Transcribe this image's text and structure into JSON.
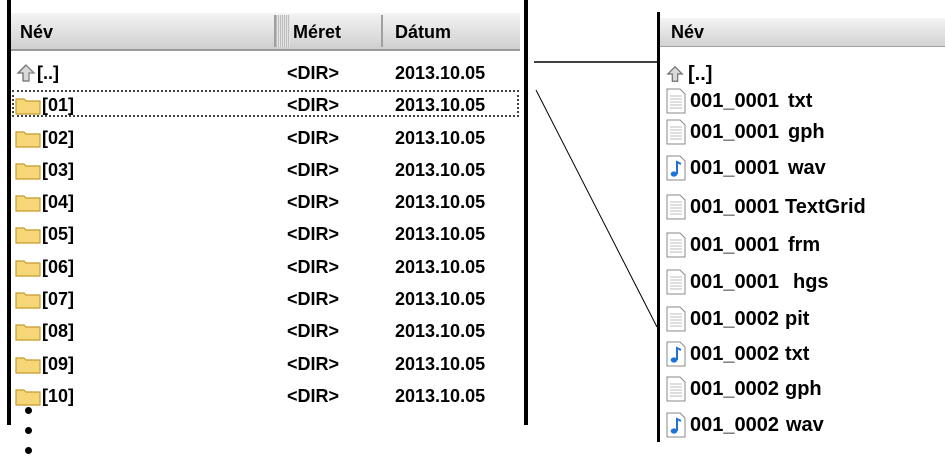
{
  "left_pane": {
    "columns": {
      "name": "Név",
      "size": "Méret",
      "date": "Dátum"
    },
    "rows": [
      {
        "name": "[..]",
        "size": "<DIR>",
        "date": "2013.10.05",
        "icon": "up-arrow-icon"
      },
      {
        "name": "[01]",
        "size": "<DIR>",
        "date": "2013.10.05",
        "icon": "folder-icon",
        "selected": true
      },
      {
        "name": "[02]",
        "size": "<DIR>",
        "date": "2013.10.05",
        "icon": "folder-icon"
      },
      {
        "name": "[03]",
        "size": "<DIR>",
        "date": "2013.10.05",
        "icon": "folder-icon"
      },
      {
        "name": "[04]",
        "size": "<DIR>",
        "date": "2013.10.05",
        "icon": "folder-icon"
      },
      {
        "name": "[05]",
        "size": "<DIR>",
        "date": "2013.10.05",
        "icon": "folder-icon"
      },
      {
        "name": "[06]",
        "size": "<DIR>",
        "date": "2013.10.05",
        "icon": "folder-icon"
      },
      {
        "name": "[07]",
        "size": "<DIR>",
        "date": "2013.10.05",
        "icon": "folder-icon"
      },
      {
        "name": "[08]",
        "size": "<DIR>",
        "date": "2013.10.05",
        "icon": "folder-icon"
      },
      {
        "name": "[09]",
        "size": "<DIR>",
        "date": "2013.10.05",
        "icon": "folder-icon"
      },
      {
        "name": "[10]",
        "size": "<DIR>",
        "date": "2013.10.05",
        "icon": "folder-icon"
      }
    ]
  },
  "right_pane": {
    "header": "Név",
    "files": [
      {
        "base": "[..]",
        "ext": "",
        "icon": "up-arrow-icon"
      },
      {
        "base": "001_0001",
        "ext": "txt",
        "icon": "text-file-icon"
      },
      {
        "base": "001_0001",
        "ext": "gph",
        "icon": "text-file-icon"
      },
      {
        "base": "001_0001",
        "ext": "wav",
        "icon": "audio-file-icon"
      },
      {
        "base": "001_0001",
        "ext": "TextGrid",
        "icon": "text-file-icon"
      },
      {
        "base": "001_0001",
        "ext": "frm",
        "icon": "text-file-icon"
      },
      {
        "base": "001_0001",
        "ext": "hgs",
        "icon": "text-file-icon"
      },
      {
        "base": "001_0002",
        "ext": "pit",
        "icon": "text-file-icon"
      },
      {
        "base": "001_0002",
        "ext": "txt",
        "icon": "audio-file-icon"
      },
      {
        "base": "001_0002",
        "ext": "gph",
        "icon": "text-file-icon"
      },
      {
        "base": "001_0002",
        "ext": "wav",
        "icon": "audio-file-icon"
      }
    ]
  },
  "colors": {
    "folder": "#f5d77a",
    "folder_edge": "#c89b2a",
    "audio_note": "#1e73d8",
    "up_arrow": "#8a8a8a"
  }
}
